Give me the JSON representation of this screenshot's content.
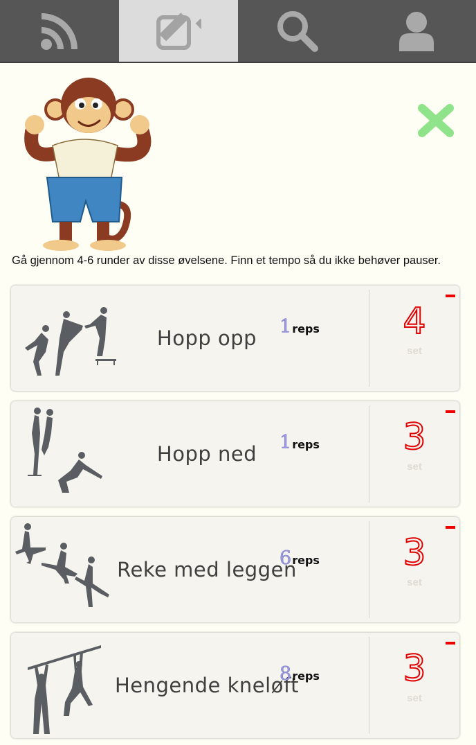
{
  "nav": {
    "items": [
      {
        "icon": "rss-icon",
        "active": false
      },
      {
        "icon": "edit-icon",
        "active": true
      },
      {
        "icon": "search-icon",
        "active": false
      },
      {
        "icon": "user-icon",
        "active": false
      }
    ],
    "bar_color": "#565656",
    "active_color": "#dcdcdc"
  },
  "header": {
    "mascot_icon": "monkey-flexing-icon",
    "close_icon": "close-x-icon",
    "close_color": "#8fe38b"
  },
  "intro": "Gå gjennom 4-6 runder av disse øvelsene. Finn et tempo så du ikke behøver pauser.",
  "exercises": [
    {
      "name": "Hopp opp",
      "reps": "1",
      "reps_label": "reps",
      "sets": "4",
      "set_label": "set",
      "figure_icon": "jump-up-figure-icon"
    },
    {
      "name": "Hopp ned",
      "reps": "1",
      "reps_label": "reps",
      "sets": "3",
      "set_label": "set",
      "figure_icon": "jump-down-figure-icon"
    },
    {
      "name": "Reke med leggen",
      "reps": "6",
      "reps_label": "reps",
      "sets": "3",
      "set_label": "set",
      "figure_icon": "lunge-figure-icon"
    },
    {
      "name": "Hengende kneløft",
      "reps": "8",
      "reps_label": "reps",
      "sets": "3",
      "set_label": "set",
      "figure_icon": "hanging-knee-raise-figure-icon"
    }
  ],
  "colors": {
    "sets": "#e00000",
    "reps": "#9c9be0",
    "remove": "#ee0000",
    "card": "#f6f4ee",
    "page": "#fffef5"
  }
}
